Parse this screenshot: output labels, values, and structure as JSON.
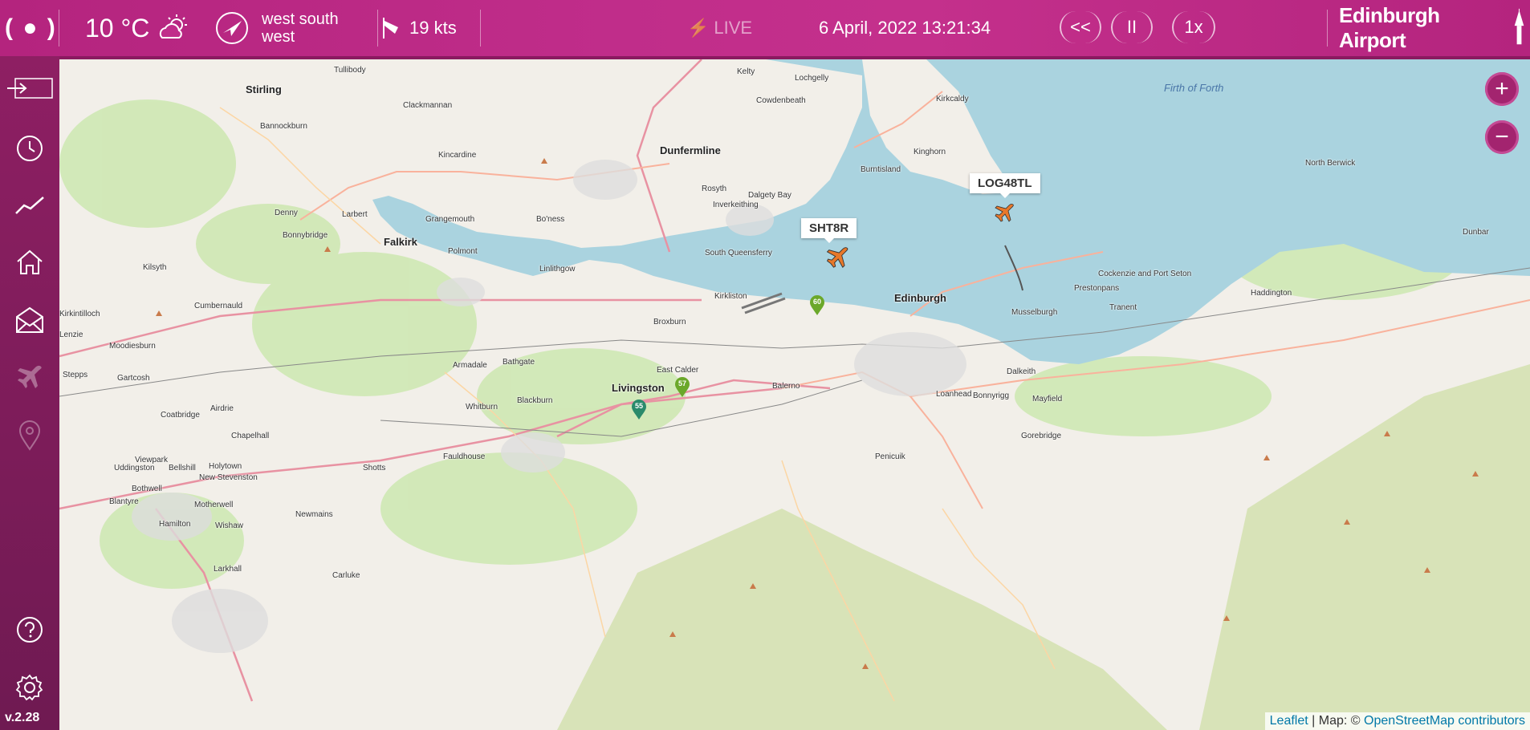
{
  "header": {
    "live_icon": "( ● )",
    "temperature": "10 °C",
    "weather_icon": "partly-cloudy-icon",
    "wind_icon": "wind-direction-icon",
    "wind_direction_line1": "west south",
    "wind_direction_line2": "west",
    "windsock_icon": "windsock-icon",
    "wind_speed": "19 kts",
    "live_label": "LIVE",
    "datetime": "6 April, 2022 13:21:34",
    "rewind_label": "<<",
    "pause_label": "II",
    "speed_label": "1x",
    "brand": "Edinburgh Airport"
  },
  "sidebar": {
    "items": [
      {
        "name": "login-icon"
      },
      {
        "name": "history-clock-icon"
      },
      {
        "name": "trend-chart-icon"
      },
      {
        "name": "home-icon"
      },
      {
        "name": "mail-icon"
      },
      {
        "name": "flights-plane-icon"
      },
      {
        "name": "location-pin-icon"
      },
      {
        "name": "help-icon"
      },
      {
        "name": "settings-gear-icon"
      }
    ],
    "version": "v.2.28"
  },
  "map": {
    "zoom_in": "+",
    "zoom_out": "−",
    "water_labels": {
      "firth": "Firth of Forth"
    },
    "places": [
      "Tullibody",
      "Stirling",
      "Kelty",
      "Lochgelly",
      "Clackmannan",
      "Cowdenbeath",
      "Kirkcaldy",
      "Bannockburn",
      "Kincardine",
      "Dunfermline",
      "Burntisland",
      "Kinghorn",
      "North Berwick",
      "Rosyth",
      "Dalgety Bay",
      "Inverkeithing",
      "Denny",
      "Larbert",
      "Grangemouth",
      "Bo'ness",
      "Falkirk",
      "Polmont",
      "Bonnybridge",
      "Kilsyth",
      "Linlithgow",
      "South Queensferry",
      "Kirkliston",
      "Edinburgh",
      "Musselburgh",
      "Prestonpans",
      "Cockenzie and Port Seton",
      "Tranent",
      "Haddington",
      "Dunbar",
      "Cumbernauld",
      "Broxburn",
      "Armadale",
      "Bathgate",
      "Livingston",
      "East Calder",
      "Balerno",
      "Loanhead",
      "Dalkeith",
      "Bonnyrigg",
      "Mayfield",
      "Moodiesburn",
      "Gartcosh",
      "Stepps",
      "Coatbridge",
      "Airdrie",
      "Blackburn",
      "Whitburn",
      "Chapelhall",
      "Viewpark",
      "Uddingston",
      "Bellshill",
      "Holytown",
      "New Stevenston",
      "Shotts",
      "Fauldhouse",
      "Bothwell",
      "Motherwell",
      "Blantyre",
      "Hamilton",
      "Wishaw",
      "Newmains",
      "Penicuik",
      "Gorebridge",
      "Carluke",
      "Larkhall",
      "Kirkintilloch",
      "Lenzie"
    ],
    "flights": [
      {
        "callsign": "LOG48TL"
      },
      {
        "callsign": "SHT8R"
      }
    ],
    "pins": [
      {
        "label": "60",
        "color": "#6ba82a"
      },
      {
        "label": "57",
        "color": "#6ba82a"
      },
      {
        "label": "55",
        "color": "#2a8a6b"
      }
    ],
    "attribution": {
      "leaflet": "Leaflet",
      "sep": " | Map: © ",
      "osm": "OpenStreetMap contributors"
    }
  },
  "colors": {
    "brand_magenta": "#c02d8a",
    "sidebar_purple": "#7d1c59",
    "water": "#aad3df",
    "land": "#f2efe9",
    "park": "#cde7b0"
  }
}
